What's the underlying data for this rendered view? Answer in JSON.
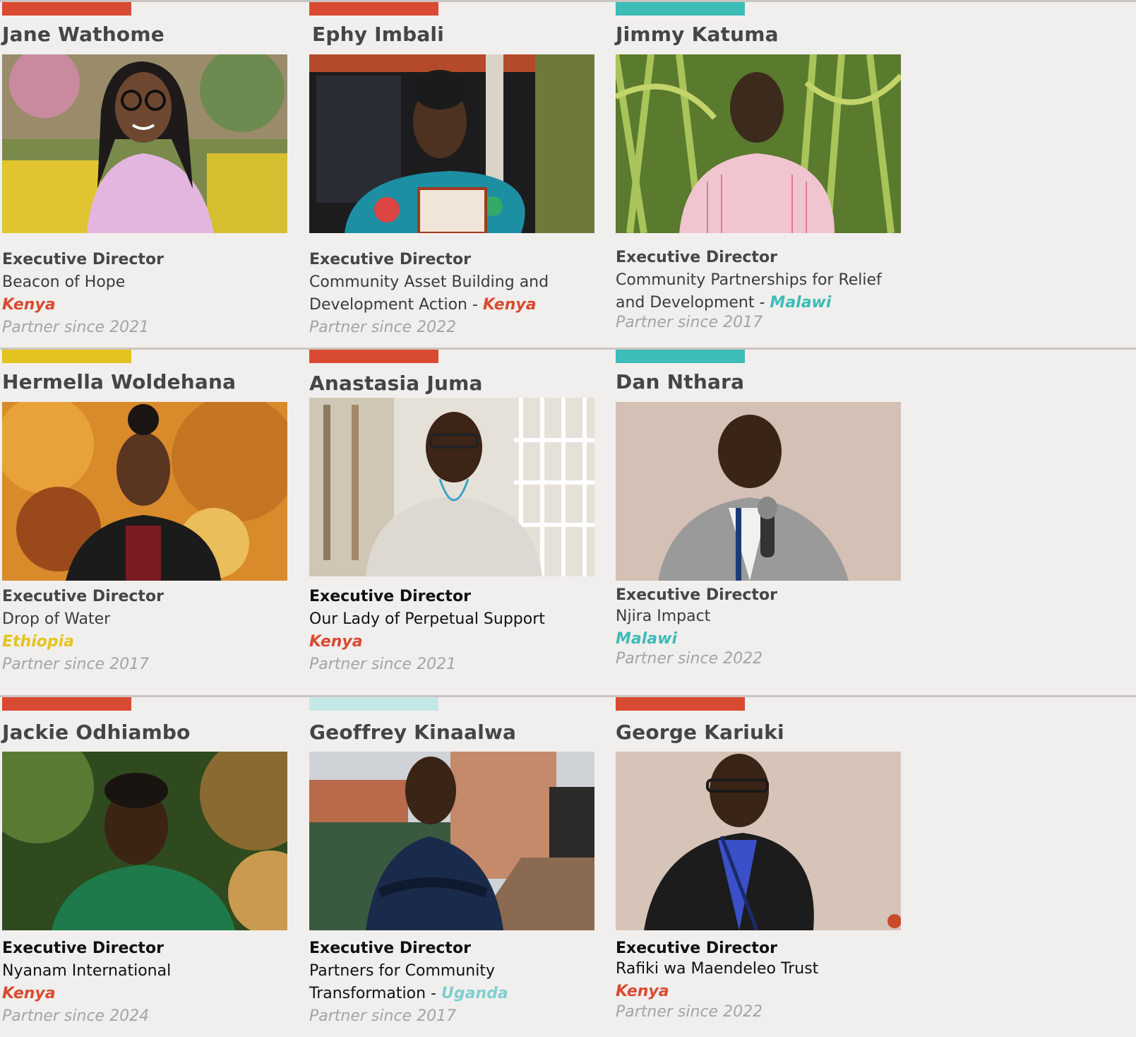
{
  "colors": {
    "kenya": "#d94a32",
    "malawi": "#3dbcb8",
    "ethiopia": "#e5c31e",
    "uganda": "#7fd0cf",
    "uganda_bar": "#c4e8e6"
  },
  "partners": [
    {
      "name": "Jane Wathome",
      "role": "Executive Director",
      "org": "Beacon of Hope",
      "country": "Kenya",
      "since": "Partner since 2021",
      "photo": "portrait of woman in pink vest with garden background"
    },
    {
      "name": "Ephy Imbali",
      "role": "Executive Director",
      "org": "Community Asset Building and Development Action - ",
      "country": "Kenya",
      "since": "Partner since 2022",
      "photo": "portrait of woman holding award plaque"
    },
    {
      "name": "Jimmy Katuma",
      "role": "Executive Director",
      "org": "Community Partnerships for Relief and Development - ",
      "country": "Malawi",
      "since": "Partner since 2017",
      "photo": "portrait of man in striped shirt in corn field"
    },
    {
      "name": "Hermella Woldehana",
      "role": "Executive Director",
      "org": "Drop of Water",
      "country": "Ethiopia",
      "since": "Partner since 2017",
      "photo": "portrait of woman with autumn foliage"
    },
    {
      "name": "Anastasia Juma",
      "role": "Executive Director",
      "org": "Our Lady of Perpetual Support",
      "country": "Kenya",
      "since": "Partner since 2021",
      "photo": "portrait of woman in white blazer indoors"
    },
    {
      "name": "Dan Nthara",
      "role": "Executive Director",
      "org": "Njira Impact",
      "country": "Malawi",
      "since": "Partner since 2022",
      "photo": "portrait of man speaking into microphone"
    },
    {
      "name": "Jackie Odhiambo",
      "role": "Executive Director",
      "org": "Nyanam International",
      "country": "Kenya",
      "since": "Partner since 2024",
      "photo": "portrait of woman in green shirt"
    },
    {
      "name": "Geoffrey Kinaalwa",
      "role": "Executive Director",
      "org": "Partners for Community Transformation - ",
      "country": "Uganda",
      "since": "Partner since 2017",
      "photo": "portrait of man with arms crossed outdoors"
    },
    {
      "name": "George Kariuki",
      "role": "Executive Director",
      "org": "Rafiki wa Maendeleo Trust",
      "country": "Kenya",
      "since": "Partner since 2022",
      "photo": "portrait of man speaking with glasses"
    }
  ]
}
